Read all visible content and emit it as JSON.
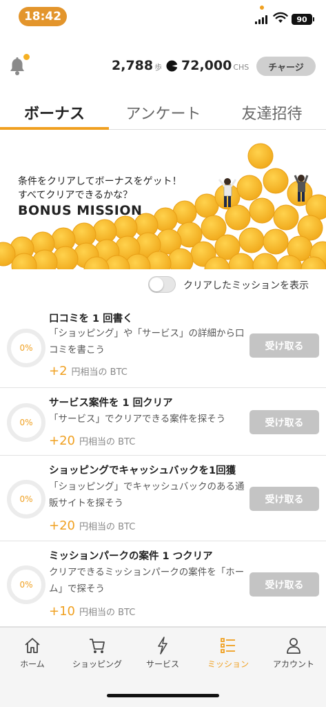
{
  "status_bar": {
    "time": "18:42",
    "battery": "90"
  },
  "header": {
    "steps_value": "2,788",
    "steps_unit": "歩",
    "chs_value": "72,000",
    "chs_unit": "CHS",
    "charge_label": "チャージ"
  },
  "tabs": [
    {
      "label": "ボーナス",
      "active": true
    },
    {
      "label": "アンケート",
      "active": false
    },
    {
      "label": "友達招待",
      "active": false
    }
  ],
  "banner": {
    "line1": "条件をクリアしてボーナスをゲット！",
    "line2": "すべてクリアできるかな？",
    "title": "BONUS MISSION"
  },
  "toggle": {
    "label": "クリアしたミッションを表示",
    "on": false
  },
  "missions": [
    {
      "title": "口コミを 1 回書く",
      "desc": "「ショッピング」や「サービス」の詳細から口コミを書こう",
      "progress": "0%",
      "reward_amount": "+2",
      "reward_unit": "円相当の BTC",
      "button": "受け取る"
    },
    {
      "title": "サービス案件を 1 回クリア",
      "desc": "「サービス」でクリアできる案件を探そう",
      "progress": "0%",
      "reward_amount": "+20",
      "reward_unit": "円相当の BTC",
      "button": "受け取る"
    },
    {
      "title": "ショッピングでキャッシュバックを1回獲",
      "desc": "「ショッピング」でキャッシュバックのある通販サイトを探そう",
      "progress": "0%",
      "reward_amount": "+20",
      "reward_unit": "円相当の BTC",
      "button": "受け取る"
    },
    {
      "title": "ミッションパークの案件 1 つクリア",
      "desc": "クリアできるミッションパークの案件を「ホーム」で探そう",
      "progress": "0%",
      "reward_amount": "+10",
      "reward_unit": "円相当の BTC",
      "button": "受け取る"
    }
  ],
  "nav": [
    {
      "label": "ホーム",
      "icon": "home-icon"
    },
    {
      "label": "ショッピング",
      "icon": "cart-icon"
    },
    {
      "label": "サービス",
      "icon": "lightning-icon"
    },
    {
      "label": "ミッション",
      "icon": "list-icon",
      "active": true
    },
    {
      "label": "アカウント",
      "icon": "person-icon"
    }
  ],
  "colors": {
    "accent": "#f0a020",
    "time_pill": "#e3952c",
    "button_disabled": "#c4c4c4"
  }
}
